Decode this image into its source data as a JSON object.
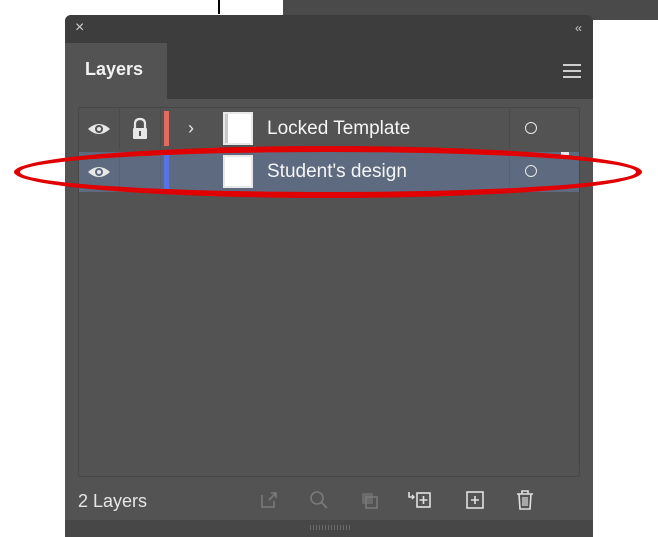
{
  "panel": {
    "close_glyph": "×",
    "collapse_glyph": "‹‹",
    "tab_label": "Layers",
    "menu_icon": "hamburger-menu-icon"
  },
  "layers": [
    {
      "name": "Locked Template",
      "visible": true,
      "locked": true,
      "expandable": true,
      "color": "#e36a5e",
      "selected": false
    },
    {
      "name": "Student's design",
      "visible": true,
      "locked": false,
      "expandable": false,
      "color": "#5774e6",
      "selected": true
    }
  ],
  "footer": {
    "count_label": "2 Layers",
    "icons": [
      "export-icon",
      "search-icon",
      "clipping-mask-icon",
      "new-sublayer-icon",
      "new-layer-icon",
      "trash-icon"
    ]
  },
  "colors": {
    "panel_bg": "#535353",
    "header_bg": "#3d3d3d",
    "selected_row": "#5d6a7f",
    "highlight_ring": "#e10000"
  }
}
